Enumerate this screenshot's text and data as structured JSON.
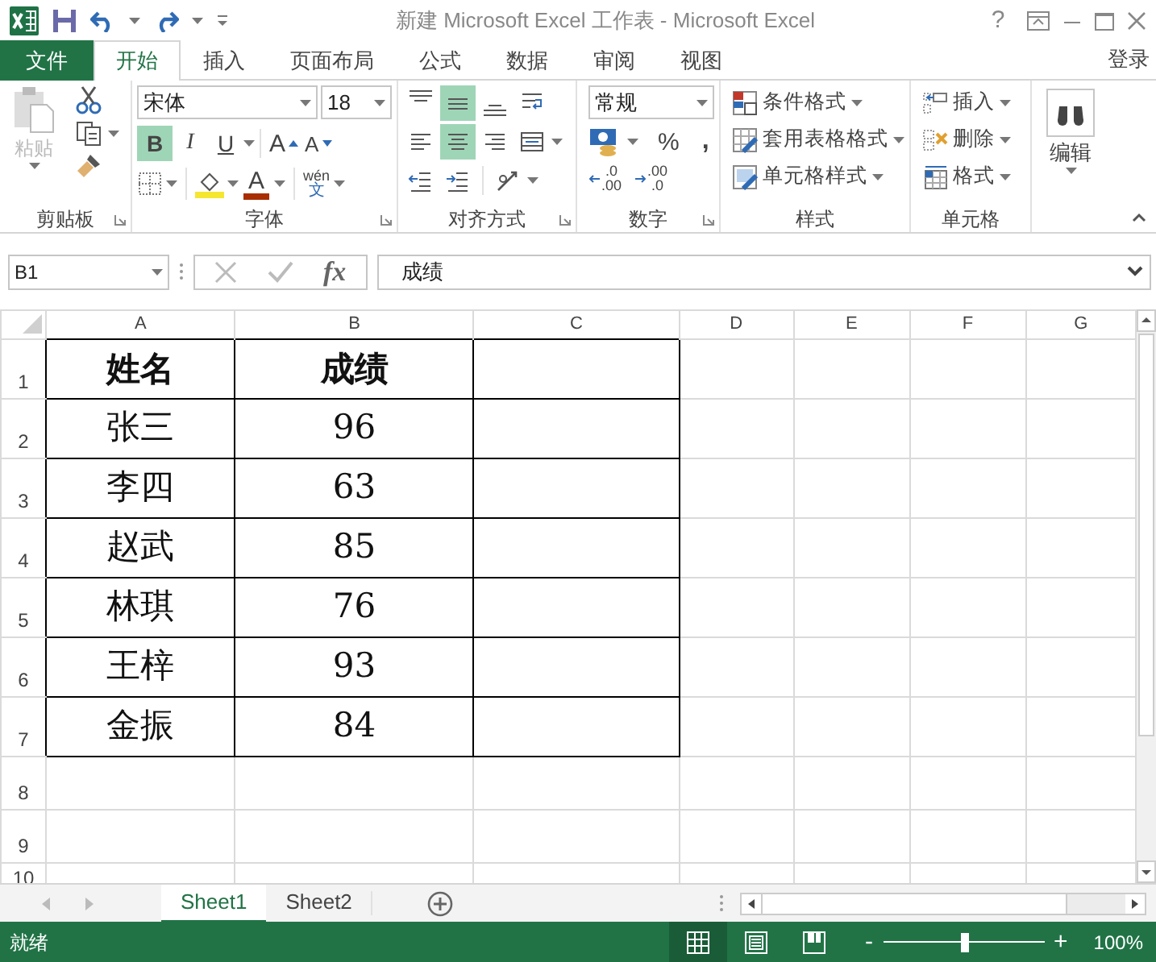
{
  "window": {
    "title": "新建 Microsoft Excel 工作表 - Microsoft Excel",
    "help": "?"
  },
  "tabs": [
    {
      "label": "文件",
      "kind": "file",
      "selected": false
    },
    {
      "label": "开始",
      "kind": "ribbon",
      "selected": true
    },
    {
      "label": "插入",
      "kind": "ribbon",
      "selected": false
    },
    {
      "label": "页面布局",
      "kind": "ribbon",
      "selected": false
    },
    {
      "label": "公式",
      "kind": "ribbon",
      "selected": false
    },
    {
      "label": "数据",
      "kind": "ribbon",
      "selected": false
    },
    {
      "label": "审阅",
      "kind": "ribbon",
      "selected": false
    },
    {
      "label": "视图",
      "kind": "ribbon",
      "selected": false
    }
  ],
  "account": "登录",
  "ribbon": {
    "clipboard": {
      "label": "剪贴板",
      "paste": "粘贴",
      "paste_disabled": true
    },
    "font": {
      "label": "字体",
      "font_name": "宋体",
      "font_size": "18",
      "styles": [
        {
          "kind": "bold",
          "text": "B",
          "selected": true
        },
        {
          "kind": "italic",
          "text": "I",
          "selected": false
        },
        {
          "kind": "underline",
          "text": "U",
          "selected": false
        }
      ],
      "grow": "A",
      "shrink": "A",
      "font_color": "A",
      "phonetic_top": "wén",
      "phonetic_bottom": "文"
    },
    "alignment": {
      "label": "对齐方式",
      "rows": [
        {
          "buttons": [
            {
              "kind": "top-align",
              "selected": false
            },
            {
              "kind": "middle-align",
              "selected": true
            },
            {
              "kind": "bottom-align",
              "selected": false
            },
            {
              "kind": "wrap-text",
              "selected": false
            }
          ]
        },
        {
          "buttons": [
            {
              "kind": "align-left",
              "selected": false
            },
            {
              "kind": "center",
              "selected": true
            },
            {
              "kind": "align-right",
              "selected": false
            },
            {
              "kind": "merge",
              "selected": false
            }
          ]
        },
        {
          "buttons": [
            {
              "kind": "decrease-indent",
              "selected": false
            },
            {
              "kind": "increase-indent",
              "selected": false
            },
            {
              "kind": "orientation",
              "selected": false
            }
          ]
        }
      ]
    },
    "number": {
      "label": "数字",
      "format": "常规",
      "percent": "%",
      "comma": ",",
      "increase_decimal": [
        ".0",
        ".00"
      ],
      "decrease_decimal": [
        ".00",
        ".0"
      ]
    },
    "styles": {
      "label": "样式",
      "items": [
        "条件格式",
        "套用表格格式",
        "单元格样式"
      ]
    },
    "cells": {
      "label": "单元格",
      "items": [
        "插入",
        "删除",
        "格式"
      ]
    },
    "editing": {
      "label": "编辑"
    }
  },
  "formula_bar": {
    "name_box": "B1",
    "function_label": "fx",
    "content": "成绩"
  },
  "sheet": {
    "columns": [
      "A",
      "B",
      "C",
      "D",
      "E",
      "F",
      "G"
    ],
    "rows": [
      {
        "number": "1",
        "bold": true,
        "bordered": true,
        "cells": [
          "姓名",
          "成绩"
        ]
      },
      {
        "number": "2",
        "bold": false,
        "bordered": true,
        "cells": [
          "张三",
          "96"
        ]
      },
      {
        "number": "3",
        "bold": false,
        "bordered": true,
        "cells": [
          "李四",
          "63"
        ]
      },
      {
        "number": "4",
        "bold": false,
        "bordered": true,
        "cells": [
          "赵武",
          "85"
        ]
      },
      {
        "number": "5",
        "bold": false,
        "bordered": true,
        "cells": [
          "林琪",
          "76"
        ]
      },
      {
        "number": "6",
        "bold": false,
        "bordered": true,
        "cells": [
          "王梓",
          "93"
        ]
      },
      {
        "number": "7",
        "bold": false,
        "bordered": true,
        "cells": [
          "金振",
          "84"
        ]
      },
      {
        "number": "8",
        "bordered": false
      },
      {
        "number": "9",
        "bordered": false
      },
      {
        "number": "10",
        "bordered": false
      }
    ]
  },
  "sheet_tabs": [
    {
      "label": "Sheet1",
      "selected": true
    },
    {
      "label": "Sheet2",
      "selected": false
    }
  ],
  "status_bar": {
    "text": "就绪",
    "views": [
      {
        "kind": "normal",
        "selected": true
      },
      {
        "kind": "page-layout",
        "selected": false
      },
      {
        "kind": "page-break",
        "selected": false
      }
    ],
    "zoom_out": "-",
    "zoom_slider": {
      "level": 0.5
    },
    "zoom_in": "+",
    "zoom": "100%"
  }
}
